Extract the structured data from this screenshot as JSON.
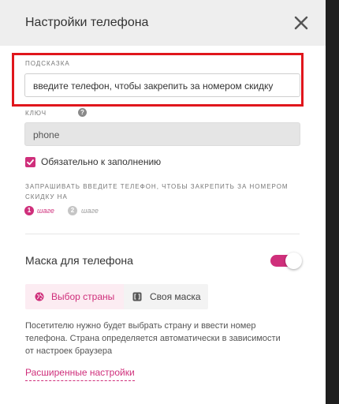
{
  "header": {
    "title": "Настройки телефона",
    "close_icon": "close-icon"
  },
  "hint_field": {
    "label": "ПОДСКАЗКА",
    "value": "введите телефон, чтобы закрепить за номером скидку"
  },
  "key_field": {
    "label": "КЛЮЧ",
    "help_glyph": "?",
    "value": "phone"
  },
  "required": {
    "checked": true,
    "label": "Обязательно к заполнению"
  },
  "ask": {
    "text": "ЗАПРАШИВАТЬ ВВЕДИТЕ ТЕЛЕФОН, ЧТОБЫ ЗАКРЕПИТЬ ЗА НОМЕРОМ СКИДКУ НА",
    "steps": [
      {
        "number": "1",
        "label": "шаге",
        "active": true
      },
      {
        "number": "2",
        "label": "шаге",
        "active": false
      }
    ]
  },
  "mask": {
    "title": "Маска для телефона",
    "enabled": true,
    "options": [
      {
        "label": "Выбор страны",
        "icon": "globe-icon",
        "selected": true
      },
      {
        "label": "Своя маска",
        "icon": "brackets-icon",
        "selected": false
      }
    ],
    "description": "Посетителю нужно будет выбрать страну и ввести номер телефона. Страна определяется автоматически в зависимости от настроек браузера"
  },
  "advanced_link": "Расширенные настройки",
  "colors": {
    "accent": "#cf2f7b",
    "highlight": "#e0161c",
    "header_bg": "#eeeeee",
    "outside_bg": "#1f1f1f"
  }
}
